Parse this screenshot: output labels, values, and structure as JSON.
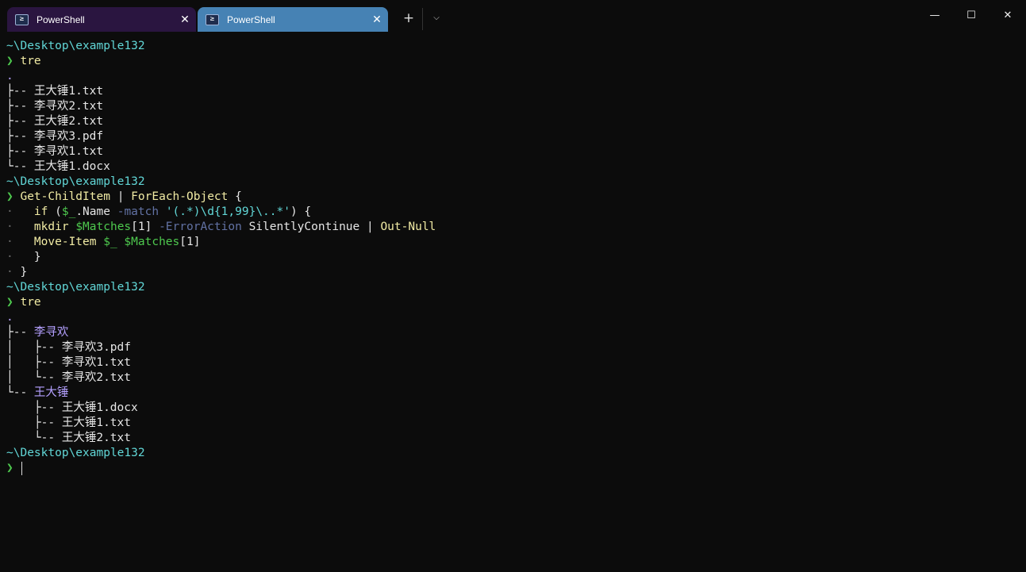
{
  "tabs": [
    {
      "label": "PowerShell",
      "icon": "powershell-icon"
    },
    {
      "label": "PowerShell",
      "icon": "powershell-icon",
      "active": true
    }
  ],
  "titlebar": {
    "new_tab": "+",
    "dropdown": "⌵",
    "minimize": "—",
    "maximize": "☐",
    "close": "✕",
    "tab_close": "✕",
    "ps_glyph": "≥"
  },
  "colors": {
    "path": "#61d6d6",
    "prompt": "#4ec94e",
    "cmd": "#f1eba4",
    "plain": "#e6e6e6",
    "var": "#4ec94e",
    "param": "#6272a4",
    "str": "#61d6d6",
    "dot": "#b4a0ff",
    "dir": "#b4a0ff",
    "dim": "#6a6a6a",
    "tree": "#e6e6e6"
  },
  "terminal": {
    "lines": [
      [
        [
          "~\\Desktop\\example132",
          "path"
        ]
      ],
      [
        [
          "❯ ",
          "prompt"
        ],
        [
          "tre",
          "cmd"
        ]
      ],
      [
        [
          ".",
          "dot"
        ]
      ],
      [
        [
          "├-- ",
          "tree"
        ],
        [
          "王大锤1.txt",
          "plain"
        ]
      ],
      [
        [
          "├-- ",
          "tree"
        ],
        [
          "李寻欢2.txt",
          "plain"
        ]
      ],
      [
        [
          "├-- ",
          "tree"
        ],
        [
          "王大锤2.txt",
          "plain"
        ]
      ],
      [
        [
          "├-- ",
          "tree"
        ],
        [
          "李寻欢3.pdf",
          "plain"
        ]
      ],
      [
        [
          "├-- ",
          "tree"
        ],
        [
          "李寻欢1.txt",
          "plain"
        ]
      ],
      [
        [
          "└-- ",
          "tree"
        ],
        [
          "王大锤1.docx",
          "plain"
        ]
      ],
      [
        [
          "~\\Desktop\\example132",
          "path"
        ]
      ],
      [
        [
          "❯ ",
          "prompt"
        ],
        [
          "Get-ChildItem",
          "cmd"
        ],
        [
          " | ",
          "plain"
        ],
        [
          "ForEach-Object",
          "cmd"
        ],
        [
          " {",
          "plain"
        ]
      ],
      [
        [
          "· ",
          "dim"
        ],
        [
          "  if ",
          "cmd"
        ],
        [
          "(",
          "plain"
        ],
        [
          "$_",
          "var"
        ],
        [
          ".Name ",
          "plain"
        ],
        [
          "-match ",
          "param"
        ],
        [
          "'(.*)\\d{1,99}\\..*'",
          "str"
        ],
        [
          ") {",
          "plain"
        ]
      ],
      [
        [
          "· ",
          "dim"
        ],
        [
          "  mkdir ",
          "cmd"
        ],
        [
          "$Matches",
          "var"
        ],
        [
          "[1] ",
          "plain"
        ],
        [
          "-ErrorAction ",
          "param"
        ],
        [
          "SilentlyContinue | ",
          "plain"
        ],
        [
          "Out-Null",
          "cmd"
        ]
      ],
      [
        [
          "· ",
          "dim"
        ],
        [
          "  Move-Item ",
          "cmd"
        ],
        [
          "$_ $Matches",
          "var"
        ],
        [
          "[1]",
          "plain"
        ]
      ],
      [
        [
          "· ",
          "dim"
        ],
        [
          "  }",
          "plain"
        ]
      ],
      [
        [
          "· ",
          "dim"
        ],
        [
          "}",
          "plain"
        ]
      ],
      [
        [
          "~\\Desktop\\example132",
          "path"
        ]
      ],
      [
        [
          "❯ ",
          "prompt"
        ],
        [
          "tre",
          "cmd"
        ]
      ],
      [
        [
          ".",
          "dot"
        ]
      ],
      [
        [
          "├-- ",
          "tree"
        ],
        [
          "李寻欢",
          "dir"
        ]
      ],
      [
        [
          "│   ├-- ",
          "tree"
        ],
        [
          "李寻欢3.pdf",
          "plain"
        ]
      ],
      [
        [
          "│   ├-- ",
          "tree"
        ],
        [
          "李寻欢1.txt",
          "plain"
        ]
      ],
      [
        [
          "│   └-- ",
          "tree"
        ],
        [
          "李寻欢2.txt",
          "plain"
        ]
      ],
      [
        [
          "└-- ",
          "tree"
        ],
        [
          "王大锤",
          "dir"
        ]
      ],
      [
        [
          "    ├-- ",
          "tree"
        ],
        [
          "王大锤1.docx",
          "plain"
        ]
      ],
      [
        [
          "    ├-- ",
          "tree"
        ],
        [
          "王大锤1.txt",
          "plain"
        ]
      ],
      [
        [
          "    └-- ",
          "tree"
        ],
        [
          "王大锤2.txt",
          "plain"
        ]
      ],
      [
        [
          "~\\Desktop\\example132",
          "path"
        ]
      ],
      [
        [
          "❯ ",
          "prompt"
        ]
      ]
    ]
  }
}
